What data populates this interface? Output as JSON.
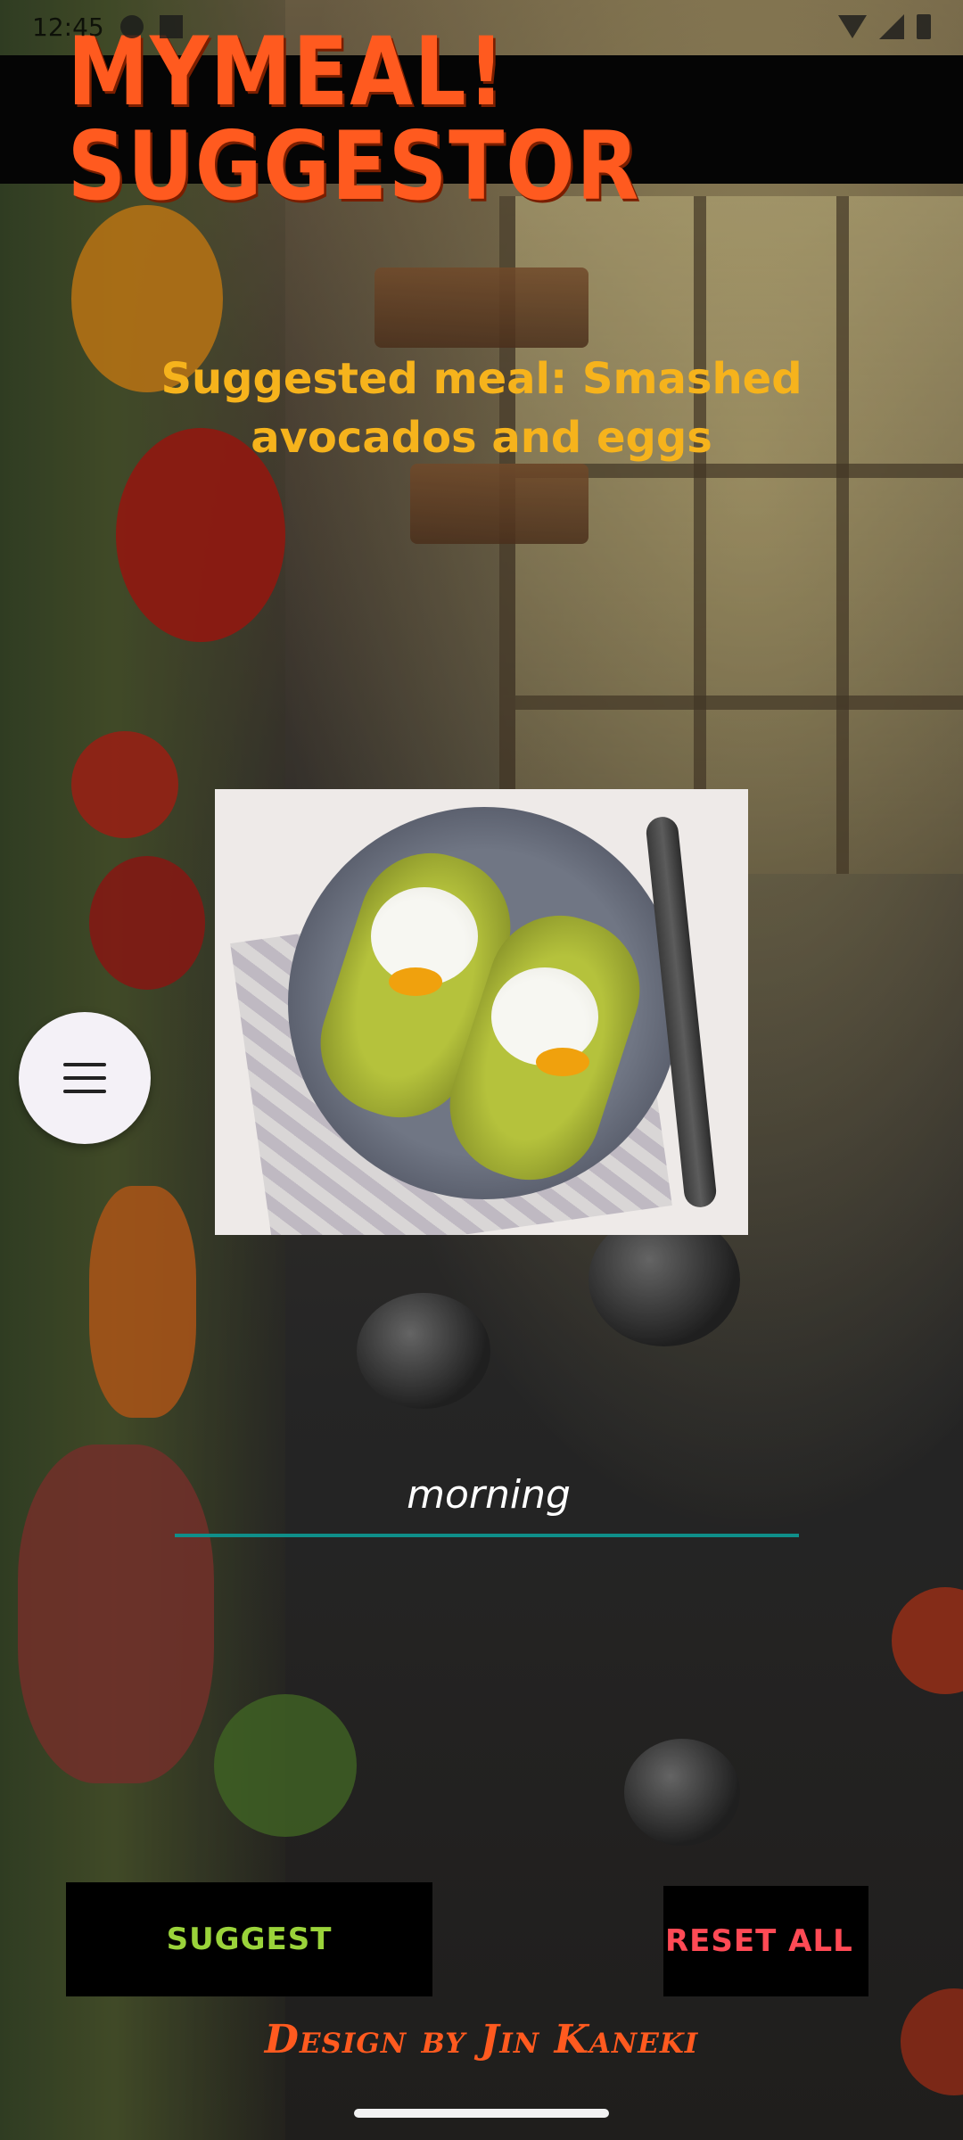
{
  "status_bar": {
    "time": "12:45",
    "icons": [
      "gear-icon",
      "sim-icon",
      "wifi-icon",
      "signal-icon",
      "battery-icon"
    ]
  },
  "header": {
    "title": "MYMEAL! SUGGESTOR"
  },
  "meal": {
    "text": "Suggested meal: Smashed avocados and eggs"
  },
  "meal_image": {
    "alt": "Smashed avocados and eggs"
  },
  "menu_button": {
    "icon": "hamburger-menu-icon"
  },
  "input": {
    "value": "morning",
    "placeholder": ""
  },
  "buttons": {
    "suggest": "SUGGEST",
    "reset": "RESET ALL"
  },
  "credit": {
    "text": "Design by Jin Kaneki"
  },
  "colors": {
    "header_bg": "#050505",
    "title": "#ff5a1f",
    "meal_text": "#f6b31c",
    "input_underline": "#0f8f8a",
    "suggest_text": "#9ad33a",
    "reset_text": "#ff4a55"
  }
}
